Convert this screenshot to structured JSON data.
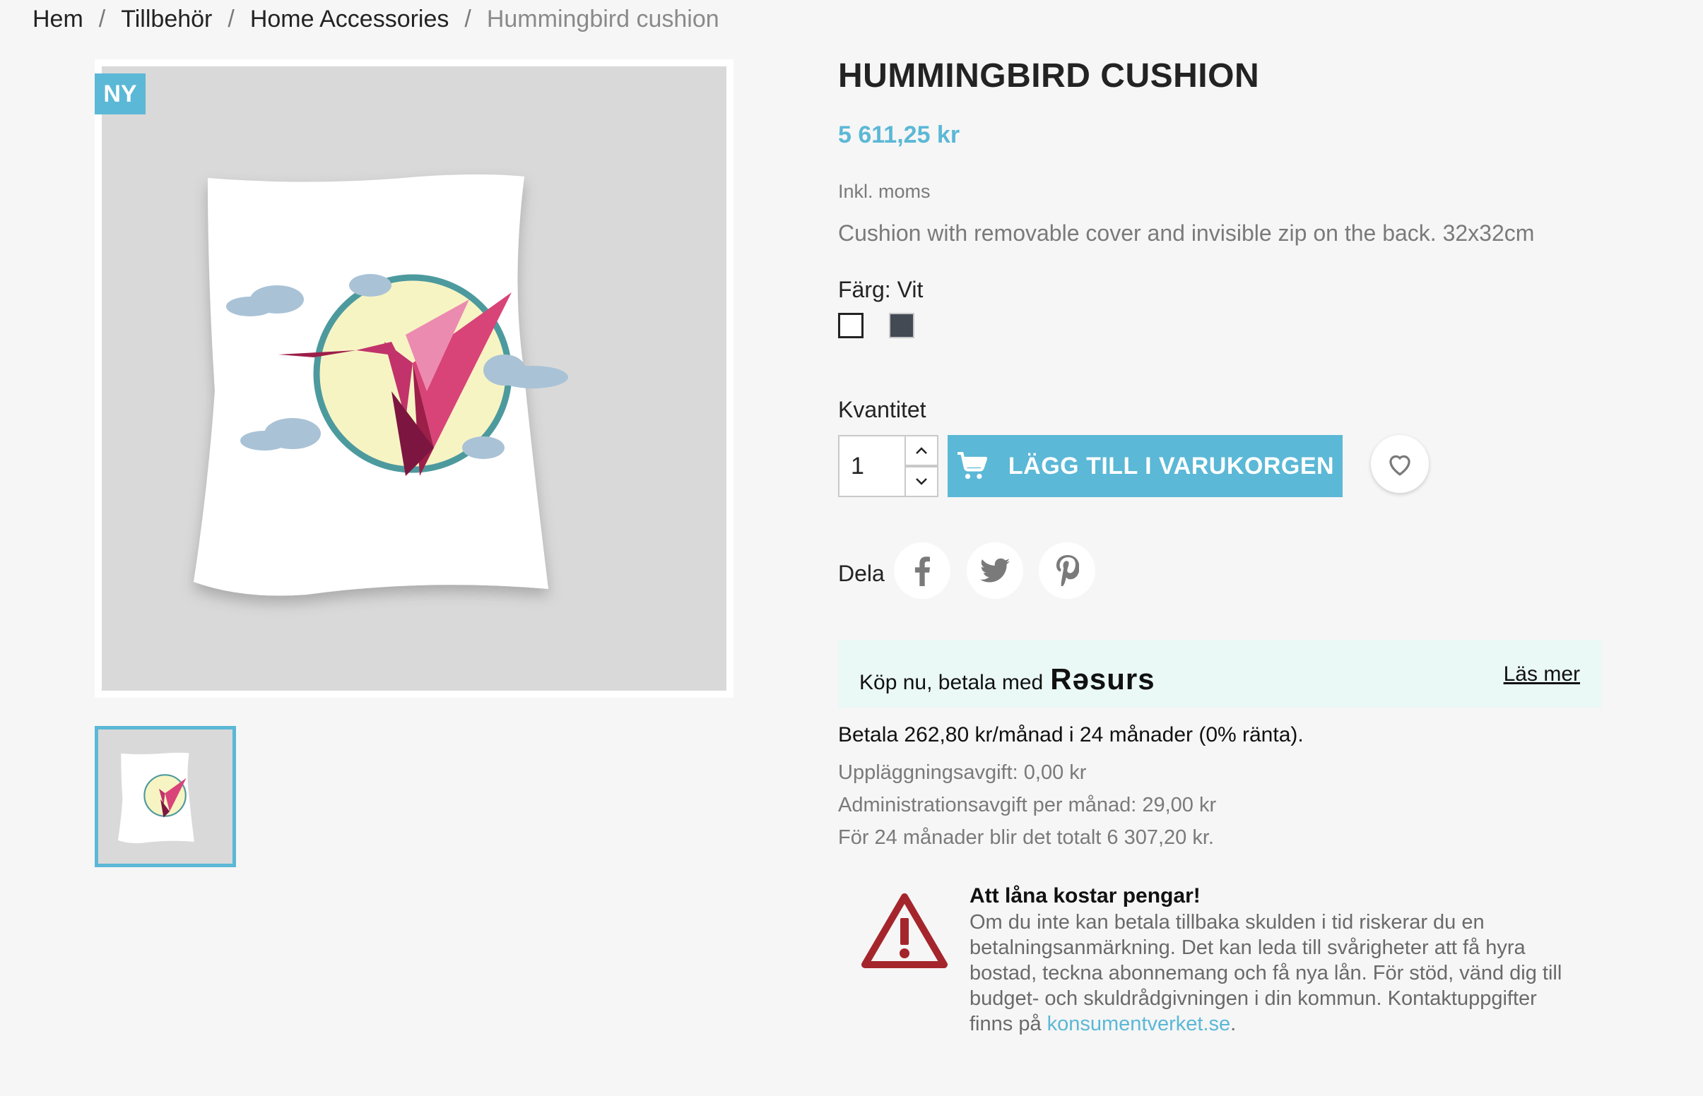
{
  "breadcrumb": [
    "Hem",
    "Tillbehör",
    "Home Accessories",
    "Hummingbird cushion"
  ],
  "badge": "NY",
  "product": {
    "title": "HUMMINGBIRD CUSHION",
    "price": "5 611,25 kr",
    "tax_note": "Inkl. moms",
    "description": "Cushion with removable cover and invisible zip on the back. 32x32cm"
  },
  "color": {
    "label": "Färg: Vit",
    "swatches": [
      {
        "name": "Vit",
        "hex": "#ffffff",
        "selected": true
      },
      {
        "name": "Grå",
        "hex": "#434a54",
        "selected": false
      }
    ]
  },
  "quantity": {
    "label": "Kvantitet",
    "value": "1"
  },
  "add_to_cart_label": "LÄGG TILL I VARUKORGEN",
  "share_label": "Dela",
  "resurs": {
    "text": "Köp nu, betala med",
    "logo": "Rəsurs",
    "read_more": "Läs mer"
  },
  "payment": {
    "monthly": "Betala 262,80 kr/månad i 24 månader (0% ränta).",
    "setup_fee": "Uppläggningsavgift: 0,00 kr",
    "admin_fee": "Administrationsavgift per månad: 29,00 kr",
    "total": "För 24 månader blir det totalt 6 307,20 kr."
  },
  "warning": {
    "title": "Att låna kostar pengar!",
    "body": "Om du inte kan betala tillbaka skulden i tid riskerar du en betalningsanmärkning. Det kan leda till svårigheter att få hyra bostad, teckna abonnemang och få nya lån. För stöd, vänd dig till budget- och skuldrådgivningen i din kommun. Kontaktuppgifter finns på",
    "link_text": "konsumentverket.se",
    "end": "."
  },
  "colors": {
    "accent": "#5bb8d6",
    "warning_red": "#a4262c",
    "resurs_bg": "#eaf8f6"
  }
}
